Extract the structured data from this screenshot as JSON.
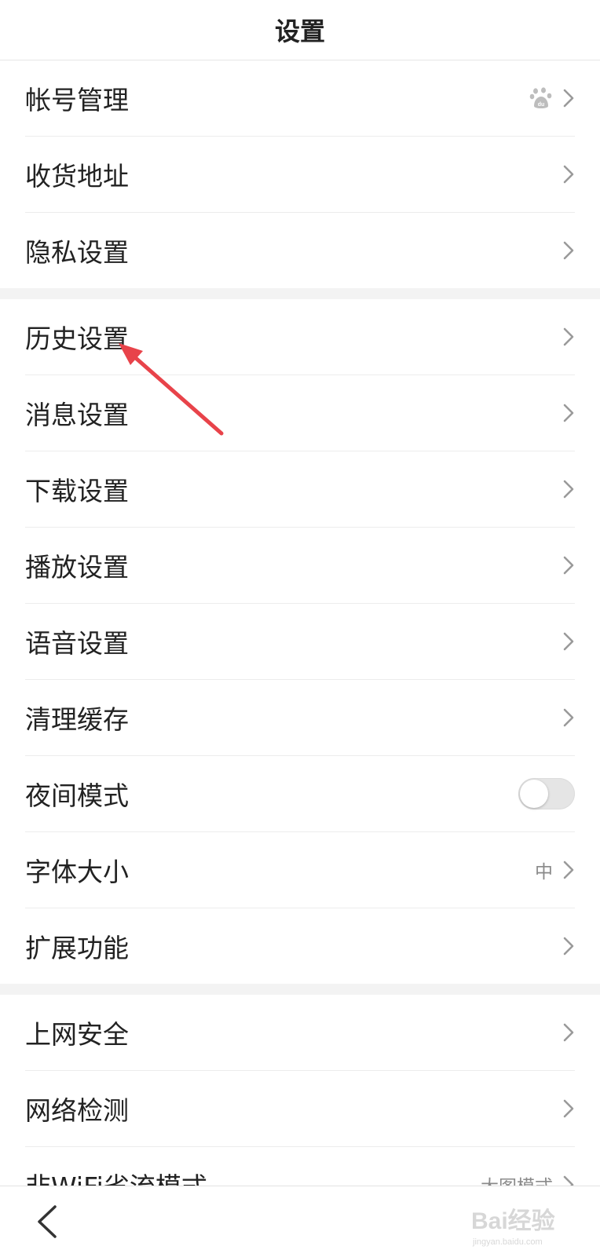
{
  "header": {
    "title": "设置"
  },
  "groups": [
    {
      "items": [
        {
          "label": "帐号管理",
          "trailing": "baidu-paw-icon"
        },
        {
          "label": "收货地址"
        },
        {
          "label": "隐私设置"
        }
      ]
    },
    {
      "items": [
        {
          "label": "历史设置"
        },
        {
          "label": "消息设置"
        },
        {
          "label": "下载设置"
        },
        {
          "label": "播放设置"
        },
        {
          "label": "语音设置"
        },
        {
          "label": "清理缓存"
        },
        {
          "label": "夜间模式",
          "toggle": false
        },
        {
          "label": "字体大小",
          "value": "中"
        },
        {
          "label": "扩展功能"
        }
      ]
    },
    {
      "items": [
        {
          "label": "上网安全"
        },
        {
          "label": "网络检测"
        },
        {
          "label": "非WiFi省流模式",
          "value": "大图模式"
        }
      ]
    }
  ],
  "bottom_bar": {
    "back_icon": "chevron-left-icon"
  },
  "watermark": {
    "text": "Bai经验",
    "subtext": "jingyan.baidu.com"
  },
  "colors": {
    "annotation_arrow": "#e8434a",
    "chevron": "#9a9a9a",
    "value_text": "#8a8a8a",
    "divider": "#ececec",
    "group_gap": "#f3f3f3"
  }
}
